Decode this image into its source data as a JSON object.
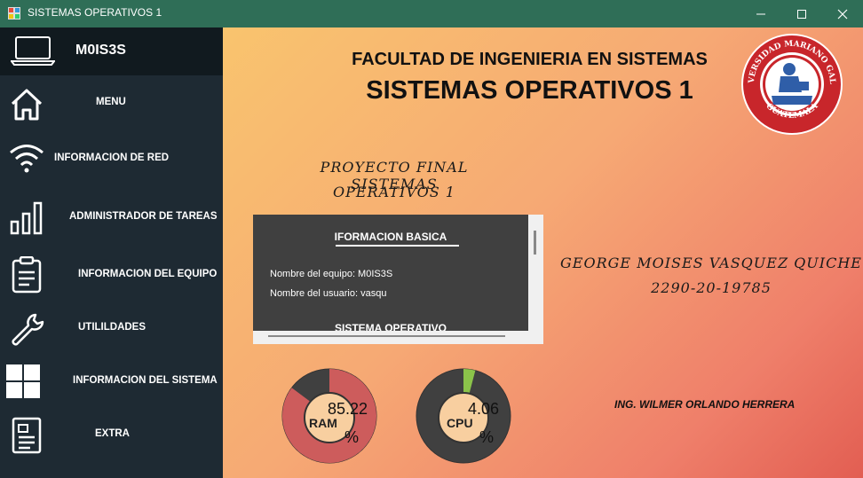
{
  "window": {
    "title": "SISTEMAS OPERATIVOS 1",
    "titlebar_color": "#2f6e57"
  },
  "sidebar": {
    "username": "M0IS3S",
    "background": "#1e2a33",
    "items": [
      {
        "label": "MENU",
        "icon": "home-icon"
      },
      {
        "label": "INFORMACION DE RED",
        "icon": "wifi-icon"
      },
      {
        "label": "ADMINISTRADOR DE TAREAS",
        "icon": "bar-chart-icon"
      },
      {
        "label": "INFORMACION DEL EQUIPO",
        "icon": "clipboard-icon"
      },
      {
        "label": "UTILILDADES",
        "icon": "wrench-icon"
      },
      {
        "label": "INFORMACION DEL SISTEMA",
        "icon": "windows-icon"
      },
      {
        "label": "EXTRA",
        "icon": "document-icon"
      }
    ]
  },
  "main": {
    "faculty": "FACULTAD DE INGENIERIA EN SISTEMAS",
    "course": "SISTEMAS OPERATIVOS 1",
    "project_line1": "PROYECTO FINAL SISTEMAS",
    "project_line2": "OPERATIVOS 1",
    "student_name": "GEORGE MOISES VASQUEZ QUICHE",
    "student_id": "2290-20-19785",
    "teacher": "ING. WILMER ORLANDO HERRERA",
    "logo": {
      "name": "university-seal",
      "top_text": "UNIVERSIDAD MARIANO GALVEZ",
      "bottom_text": "GUATEMALA"
    }
  },
  "info_panel": {
    "section1_title": "IFORMACION BASICA",
    "rows": [
      "Nombre del equipo: M0IS3S",
      "Nombre del usuario: vasqu"
    ],
    "section2_title": "SISTEMA OPERATIVO"
  },
  "gauges": {
    "ram": {
      "label": "RAM",
      "value": "85.22",
      "unit": "%",
      "fraction": 0.8522,
      "color": "#cd5c5c"
    },
    "cpu": {
      "label": "CPU",
      "value": "4.06",
      "unit": "%",
      "fraction": 0.0406,
      "color": "#8bc34a"
    }
  }
}
